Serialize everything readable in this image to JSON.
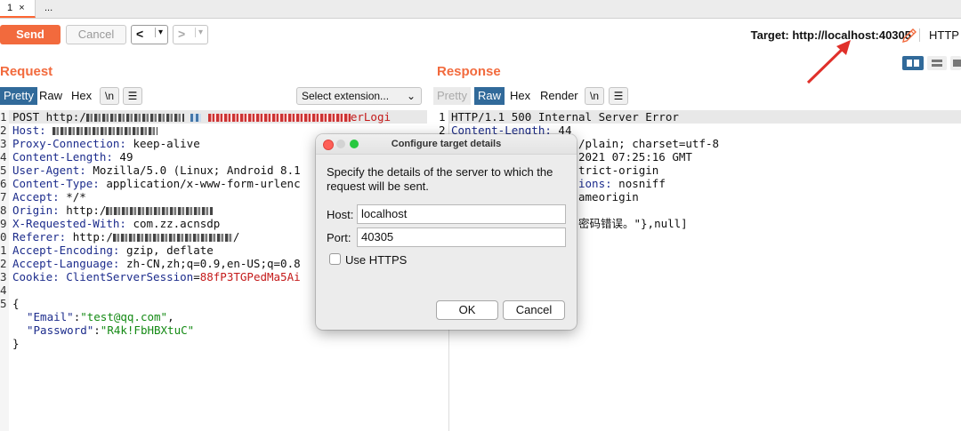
{
  "tabs": [
    {
      "label": "1"
    },
    {
      "label": "..."
    }
  ],
  "tab_close": "×",
  "toolbar": {
    "send_label": "Send",
    "cancel_label": "Cancel",
    "back_glyph": "<",
    "forward_glyph": ">",
    "dropdown_glyph": "▾",
    "target_text": "Target: http://localhost:40305",
    "protocol_text": "HTTP"
  },
  "request": {
    "title": "Request",
    "tabs": [
      "Pretty",
      "Raw",
      "Hex"
    ],
    "newline_label": "\\n",
    "menu_glyph": "☰",
    "extension_select": "Select extension...",
    "line_numbers": [
      "1",
      "2",
      "3",
      "4",
      "5",
      "6",
      "7",
      "8",
      "9",
      "0",
      "1",
      "2",
      "3",
      "4",
      "5"
    ],
    "lines": {
      "l1_prefix": "POST http:/",
      "l1_suffix": "erLogi",
      "l2_key": "Host:",
      "l3_key": "Proxy-Connection:",
      "l3_val": " keep-alive",
      "l4_key": "Content-Length:",
      "l4_val": " 49",
      "l5_key": "User-Agent:",
      "l5_val": " Mozilla/5.0 (Linux; Android 8.1",
      "l6_key": "Content-Type:",
      "l6_val": " application/x-www-form-urlenc",
      "l7_key": "Accept:",
      "l7_val": " */*",
      "l8_key": "Origin:",
      "l8_val": " http:/",
      "l9_key": "X-Requested-With:",
      "l9_val": " com.zz.acnsdp",
      "l10_key": "Referer:",
      "l10_val": " http:/",
      "l10_end": "/",
      "l11_key": "Accept-Encoding:",
      "l11_val": " gzip, deflate",
      "l12_key": "Accept-Language:",
      "l12_val": " zh-CN,zh;q=0.9,en-US;q=0.8",
      "l13_key": "Cookie:",
      "l13_name": " ClientServerSession",
      "l13_eq": "=",
      "l13_val": "88fP3TGPedMa5Ai",
      "b_open": "{",
      "b_email_key": "\"Email\"",
      "b_colon": ":",
      "b_email_val": "\"test@qq.com\"",
      "b_comma": ",",
      "b_pass_key": "\"Password\"",
      "b_pass_val": "\"R4k!FbHBXtuC\"",
      "b_close": "}"
    }
  },
  "response": {
    "title": "Response",
    "tabs": [
      "Pretty",
      "Raw",
      "Hex",
      "Render"
    ],
    "newline_label": "\\n",
    "menu_glyph": "☰",
    "line_numbers": [
      "1",
      "2"
    ],
    "lines": {
      "r1": "HTTP/1.1 500 Internal Server Error",
      "r2_key": "Content-Length:",
      "r2_val": " 44",
      "r3_tail": "/plain; charset=utf-8",
      "r4_tail": "2021 07:25:16 GMT",
      "r5_tail": "trict-origin",
      "r6_key_tail": "ions:",
      "r6_val": " nosniff",
      "r7_tail": "ameorigin",
      "r9_tail": "密码错误。\"},null]"
    }
  },
  "dialog": {
    "title": "Configure target details",
    "description": "Specify the details of the server to which the request will be sent.",
    "host_label": "Host:",
    "host_value": "localhost",
    "port_label": "Port:",
    "port_value": "40305",
    "https_label": "Use HTTPS",
    "https_checked": false,
    "ok_label": "OK",
    "cancel_label": "Cancel"
  },
  "colors": {
    "accent": "#f26a3d",
    "selected_tab": "#316a9a",
    "arrow": "#e0302a"
  },
  "icons": [
    "edit-pencil-icon",
    "layout-split-icon",
    "annotation-arrow-icon"
  ]
}
